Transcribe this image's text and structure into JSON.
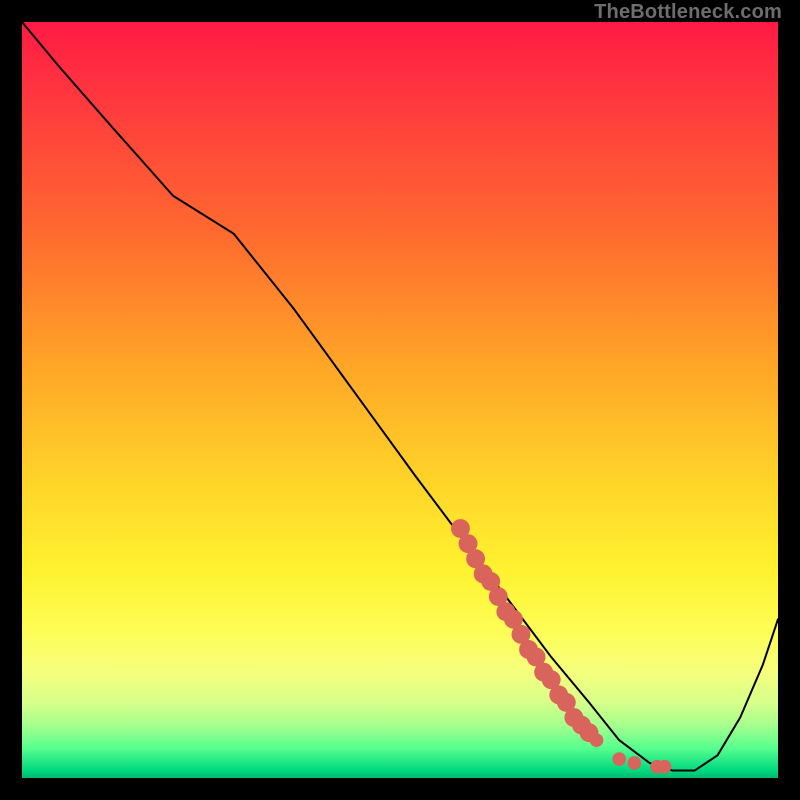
{
  "attribution": "TheBottleneck.com",
  "chart_data": {
    "type": "line",
    "title": "",
    "xlabel": "",
    "ylabel": "",
    "xlim": [
      0,
      100
    ],
    "ylim": [
      0,
      100
    ],
    "grid": false,
    "legend": false,
    "series": [
      {
        "name": "curve",
        "color": "#000000",
        "x": [
          0,
          5,
          12,
          20,
          28,
          36,
          44,
          52,
          58,
          64,
          70,
          75,
          79,
          83,
          86,
          89,
          92,
          95,
          98,
          100
        ],
        "y": [
          100,
          94,
          86,
          77,
          72,
          62,
          51,
          40,
          32,
          24,
          16,
          10,
          5,
          2,
          1,
          1,
          3,
          8,
          15,
          21
        ]
      }
    ],
    "highlight": {
      "name": "highlight-dots",
      "color": "#d9645b",
      "points": [
        {
          "x": 58,
          "y": 33
        },
        {
          "x": 59,
          "y": 31
        },
        {
          "x": 60,
          "y": 29
        },
        {
          "x": 61,
          "y": 27
        },
        {
          "x": 62,
          "y": 26
        },
        {
          "x": 63,
          "y": 24
        },
        {
          "x": 64,
          "y": 22
        },
        {
          "x": 65,
          "y": 21
        },
        {
          "x": 66,
          "y": 19
        },
        {
          "x": 67,
          "y": 17
        },
        {
          "x": 68,
          "y": 16
        },
        {
          "x": 69,
          "y": 14
        },
        {
          "x": 70,
          "y": 13
        },
        {
          "x": 71,
          "y": 11
        },
        {
          "x": 72,
          "y": 10
        },
        {
          "x": 73,
          "y": 8
        },
        {
          "x": 74,
          "y": 7
        },
        {
          "x": 75,
          "y": 6
        },
        {
          "x": 76,
          "y": 5
        },
        {
          "x": 79,
          "y": 2.5
        },
        {
          "x": 81,
          "y": 2
        },
        {
          "x": 84,
          "y": 1.5
        },
        {
          "x": 85,
          "y": 1.5
        }
      ]
    }
  }
}
